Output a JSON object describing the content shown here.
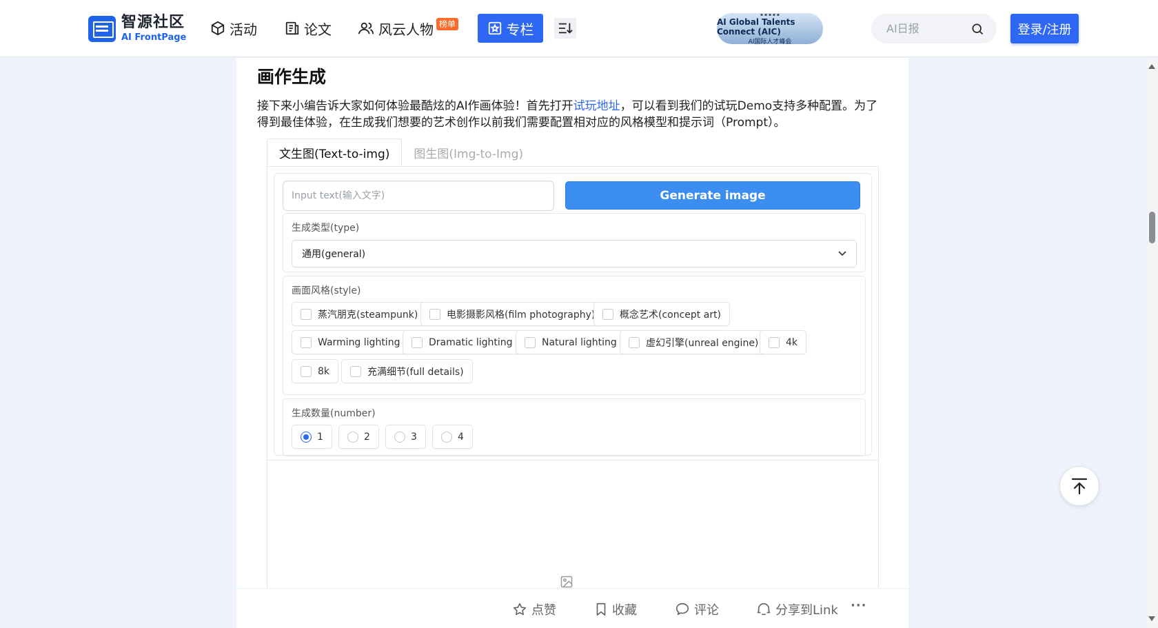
{
  "header": {
    "logo_cn": "智源社区",
    "logo_en": "AI FrontPage",
    "nav": {
      "huodong": "活动",
      "lunwen": "论文",
      "people": "风云人物",
      "people_badge": "榜单",
      "zhuanlan": "专栏"
    },
    "aic": {
      "main": "AI Global Talents Connect (AIC)",
      "sub": "AI国际人才峰会"
    },
    "search_placeholder": "AI日报",
    "login_label": "登录/注册"
  },
  "article": {
    "heading": "画作生成",
    "para_part1": "接下来小编告诉大家如何体验最酷炫的AI作画体验！首先打开",
    "para_link": "试玩地址",
    "para_part2": "，可以看到我们的试玩Demo支持多种配置。为了得到最佳体验，在生成我们想要的艺术创作以前我们需要配置相对应的风格模型和提示词（Prompt）。"
  },
  "demo": {
    "tabs": [
      "文生图(Text-to-img)",
      "图生图(Img-to-Img)"
    ],
    "active_tab": 0,
    "input_placeholder": "Input text(输入文字)",
    "generate_label": "Generate image",
    "type": {
      "label": "生成类型(type)",
      "selected": "通用(general)"
    },
    "style": {
      "label": "画面风格(style)",
      "options": [
        "蒸汽朋克(steampunk)",
        "电影摄影风格(film photography)",
        "概念艺术(concept art)",
        "Warming lighting",
        "Dramatic lighting",
        "Natural lighting",
        "虚幻引擎(unreal engine)",
        "4k",
        "8k",
        "充满细节(full details)"
      ]
    },
    "number": {
      "label": "生成数量(number)",
      "options": [
        "1",
        "2",
        "3",
        "4"
      ],
      "selected": "1"
    }
  },
  "actions": {
    "like": "点赞",
    "favorite": "收藏",
    "comment": "评论",
    "share": "分享到Link",
    "more": "···"
  },
  "colors": {
    "brand_blue": "#2f67f5",
    "generate_blue": "#3c8df0",
    "page_bg": "#eef2fa",
    "badge_orange": "#ff6a2b"
  }
}
